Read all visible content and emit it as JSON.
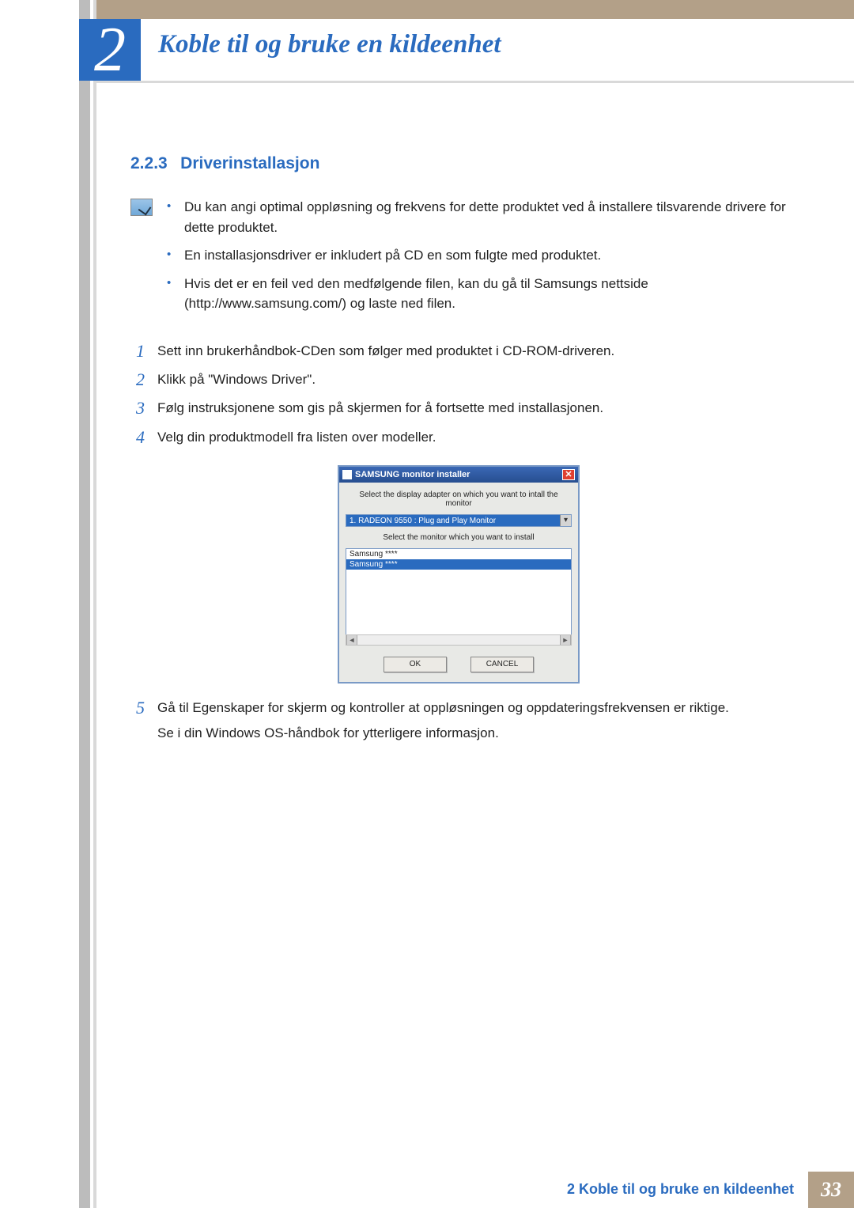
{
  "chapter": {
    "number": "2",
    "title": "Koble til og bruke en kildeenhet"
  },
  "section": {
    "number": "2.2.3",
    "title": "Driverinstallasjon"
  },
  "notes": [
    "Du kan angi optimal oppløsning og frekvens for dette produktet ved å installere tilsvarende drivere for dette produktet.",
    "En installasjonsdriver er inkludert på CD en som fulgte med produktet.",
    "Hvis det er en feil ved den medfølgende filen, kan du gå til Samsungs nettside (http://www.samsung.com/) og laste ned filen."
  ],
  "steps": {
    "s1": "Sett inn brukerhåndbok-CDen som følger med produktet i CD-ROM-driveren.",
    "s2": "Klikk på \"Windows Driver\".",
    "s3": "Følg instruksjonene som gis på skjermen for å fortsette med installasjonen.",
    "s4": "Velg din produktmodell fra listen over modeller.",
    "s5a": "Gå til Egenskaper for skjerm og kontroller at oppløsningen og oppdateringsfrekvensen er riktige.",
    "s5b": "Se i din Windows OS-håndbok for ytterligere informasjon."
  },
  "step_numbers": {
    "n1": "1",
    "n2": "2",
    "n3": "3",
    "n4": "4",
    "n5": "5"
  },
  "installer": {
    "title": "SAMSUNG monitor installer",
    "close_glyph": "✕",
    "label_adapter": "Select the display adapter on which you want to intall the monitor",
    "adapter_selected": "1. RADEON 9550 : Plug and Play Monitor",
    "dropdown_glyph": "▾",
    "label_monitor": "Select the monitor which you want to install",
    "list_item_0": "Samsung ****",
    "list_item_1_selected": "Samsung ****",
    "scroll_left": "◄",
    "scroll_right": "►",
    "ok_label": "OK",
    "cancel_label": "CANCEL"
  },
  "footer": {
    "text": "2 Koble til og bruke en kildeenhet",
    "page": "33"
  }
}
